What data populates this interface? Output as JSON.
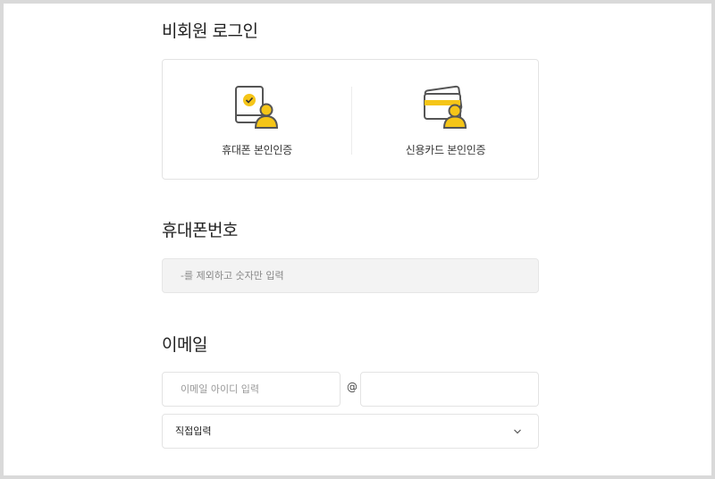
{
  "login": {
    "title": "비회원 로그인",
    "phone_auth_label": "휴대폰 본인인증",
    "phone_auth_icon": "phone-user-check-icon",
    "card_auth_label": "신용카드 본인인증",
    "card_auth_icon": "credit-card-user-icon"
  },
  "phone": {
    "title": "휴대폰번호",
    "placeholder": "-를 제외하고 숫자만 입력"
  },
  "email": {
    "title": "이메일",
    "id_placeholder": "이메일 아이디 입력",
    "at": "@",
    "domain_value": "",
    "domain_select_value": "직접입력",
    "chevron_icon": "chevron-down-icon"
  },
  "colors": {
    "accent_yellow": "#f5c518",
    "icon_gray": "#5a5a5a",
    "input_bg": "#f3f3f3",
    "border": "#e3e3e3"
  }
}
